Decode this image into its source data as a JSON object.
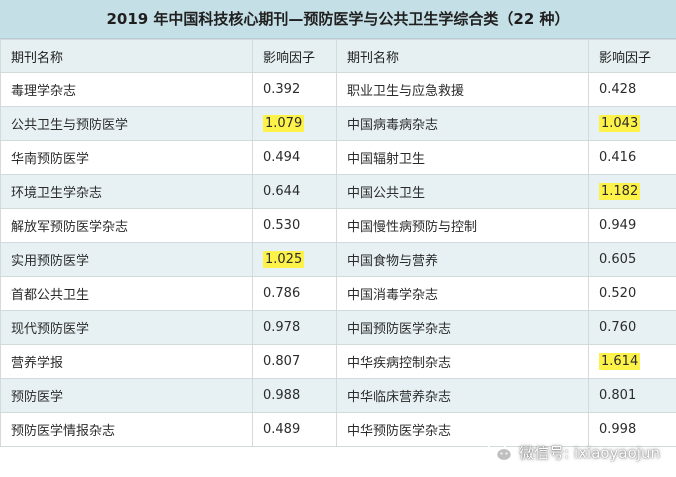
{
  "title": "2019 年中国科技核心期刊—预防医学与公共卫生学综合类（22 种）",
  "headers": [
    "期刊名称",
    "影响因子",
    "期刊名称",
    "影响因子"
  ],
  "rows": [
    {
      "n1": "毒理学杂志",
      "v1": "0.392",
      "h1": false,
      "n2": "职业卫生与应急救援",
      "v2": "0.428",
      "h2": false
    },
    {
      "n1": "公共卫生与预防医学",
      "v1": "1.079",
      "h1": true,
      "n2": "中国病毒病杂志",
      "v2": "1.043",
      "h2": true
    },
    {
      "n1": "华南预防医学",
      "v1": "0.494",
      "h1": false,
      "n2": "中国辐射卫生",
      "v2": "0.416",
      "h2": false
    },
    {
      "n1": "环境卫生学杂志",
      "v1": "0.644",
      "h1": false,
      "n2": "中国公共卫生",
      "v2": "1.182",
      "h2": true
    },
    {
      "n1": "解放军预防医学杂志",
      "v1": "0.530",
      "h1": false,
      "n2": "中国慢性病预防与控制",
      "v2": "0.949",
      "h2": false
    },
    {
      "n1": "实用预防医学",
      "v1": "1.025",
      "h1": true,
      "n2": "中国食物与营养",
      "v2": "0.605",
      "h2": false
    },
    {
      "n1": "首都公共卫生",
      "v1": "0.786",
      "h1": false,
      "n2": "中国消毒学杂志",
      "v2": "0.520",
      "h2": false
    },
    {
      "n1": "现代预防医学",
      "v1": "0.978",
      "h1": false,
      "n2": "中国预防医学杂志",
      "v2": "0.760",
      "h2": false
    },
    {
      "n1": "营养学报",
      "v1": "0.807",
      "h1": false,
      "n2": "中华疾病控制杂志",
      "v2": "1.614",
      "h2": true
    },
    {
      "n1": "预防医学",
      "v1": "0.988",
      "h1": false,
      "n2": "中华临床营养杂志",
      "v2": "0.801",
      "h2": false
    },
    {
      "n1": "预防医学情报杂志",
      "v1": "0.489",
      "h1": false,
      "n2": "中华预防医学杂志",
      "v2": "0.998",
      "h2": false
    }
  ],
  "highlight_color": "#fdf24a",
  "watermark": {
    "icon": "wechat-icon",
    "text": "微信号: ixiaoyaojun"
  }
}
